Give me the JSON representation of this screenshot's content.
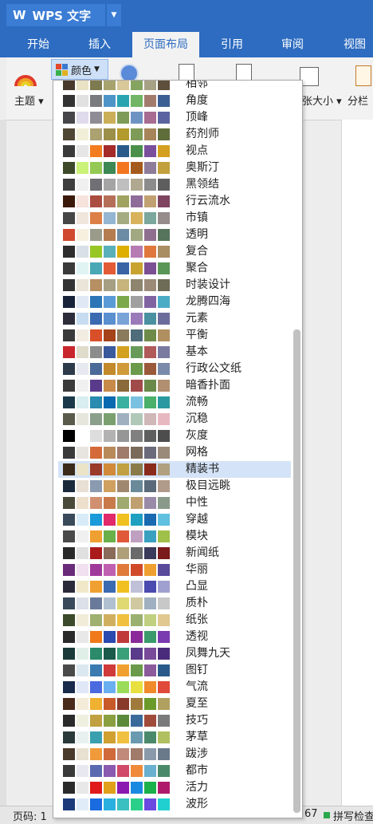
{
  "app": {
    "title": "WPS 文字",
    "logo_glyph": "W"
  },
  "tabs": [
    {
      "label": "开始"
    },
    {
      "label": "插入"
    },
    {
      "label": "页面布局",
      "active": true
    },
    {
      "label": "引用"
    },
    {
      "label": "审阅"
    },
    {
      "label": "视图"
    }
  ],
  "ribbon": {
    "theme_label": "主题",
    "colors_label": "颜色",
    "size_label": "纸张大小",
    "columns_label": "分栏"
  },
  "status": {
    "page_label": "页码: 1",
    "right_num": "67",
    "spellcheck": "拼写检查"
  },
  "color_schemes": [
    {
      "name": "相邻",
      "colors": [
        "#47392c",
        "#e9e2c5",
        "#7e7a4f",
        "#a6a36e",
        "#d8c89a",
        "#84a460",
        "#a6a084",
        "#5e4f3c"
      ]
    },
    {
      "name": "角度",
      "colors": [
        "#333333",
        "#e1e1e1",
        "#797b7e",
        "#4e95c7",
        "#2aa4b0",
        "#71b566",
        "#a37b6d",
        "#3c5f93"
      ]
    },
    {
      "name": "顶峰",
      "colors": [
        "#46464a",
        "#dfdbeb",
        "#8f8c95",
        "#cbaf58",
        "#7f9b59",
        "#6e93c3",
        "#a86c92",
        "#5c64a0"
      ]
    },
    {
      "name": "药剂师",
      "colors": [
        "#4f4633",
        "#f2efd8",
        "#aca171",
        "#9b8f4a",
        "#b39a2c",
        "#7e9b58",
        "#a8845a",
        "#5f6d3b"
      ]
    },
    {
      "name": "视点",
      "colors": [
        "#3a3a3a",
        "#e6e6e6",
        "#f37c20",
        "#a52a2a",
        "#2a5a8c",
        "#4a8f4a",
        "#7a4f9c",
        "#d4a020"
      ]
    },
    {
      "name": "奥斯汀",
      "colors": [
        "#3c4a2a",
        "#caf278",
        "#94c954",
        "#3e8853",
        "#f3761e",
        "#a55a1d",
        "#8e7c9a",
        "#c2a03d"
      ]
    },
    {
      "name": "黑领结",
      "colors": [
        "#3e3e3e",
        "#f0f0f0",
        "#6f6f74",
        "#a5a5a5",
        "#bfbfbf",
        "#b0a890",
        "#8c8c8c",
        "#5e5e5e"
      ]
    },
    {
      "name": "行云流水",
      "colors": [
        "#3b1a0b",
        "#f6e3dc",
        "#ab4c41",
        "#b56f59",
        "#a1a360",
        "#8e6b98",
        "#c1a172",
        "#7e4460"
      ]
    },
    {
      "name": "市镇",
      "colors": [
        "#464646",
        "#f0e6dc",
        "#dd8047",
        "#94b6d2",
        "#a5ab81",
        "#d8b25c",
        "#7ba79d",
        "#968c8c"
      ]
    },
    {
      "name": "透明",
      "colors": [
        "#d0492e",
        "#f7f0df",
        "#9b9b8b",
        "#b47c4f",
        "#6c8ba5",
        "#a1a882",
        "#8f6f8f",
        "#56745c"
      ]
    },
    {
      "name": "复合",
      "colors": [
        "#2d2d2d",
        "#d9e0e6",
        "#98c723",
        "#59b0b9",
        "#deae00",
        "#b77bb4",
        "#e0773c",
        "#a98d63"
      ]
    },
    {
      "name": "聚合",
      "colors": [
        "#3a3a3a",
        "#e0f4f4",
        "#4aa8b6",
        "#e35b36",
        "#3a63a6",
        "#c8a330",
        "#7c4f94",
        "#5a9656"
      ]
    },
    {
      "name": "时装设计",
      "colors": [
        "#333333",
        "#eae5d8",
        "#b68f63",
        "#a69f83",
        "#c7b47c",
        "#8e8570",
        "#9c8a78",
        "#6e6b56"
      ]
    },
    {
      "name": "龙腾四海",
      "colors": [
        "#18233a",
        "#e0e8f4",
        "#2d75b6",
        "#5b9bd5",
        "#7aa84a",
        "#a0a0a0",
        "#8064a2",
        "#4bacc6"
      ]
    },
    {
      "name": "元素",
      "colors": [
        "#2c2c3a",
        "#c7dcf0",
        "#3a6bb0",
        "#5a8fd0",
        "#7aa3d8",
        "#9a7ab8",
        "#4a90a0",
        "#6c6c9c"
      ]
    },
    {
      "name": "平衡",
      "colors": [
        "#3a3a3a",
        "#f2ece2",
        "#d94f2a",
        "#a5441a",
        "#8a7b5c",
        "#4f6c7a",
        "#6e8b4a",
        "#b09060"
      ]
    },
    {
      "name": "基本",
      "colors": [
        "#c8252c",
        "#e0dccc",
        "#8c8c8c",
        "#3a5a9c",
        "#d4a020",
        "#6a9a5a",
        "#b05a5a",
        "#7a7aa0"
      ]
    },
    {
      "name": "行政公文纸",
      "colors": [
        "#2c3a4a",
        "#e6eaf0",
        "#4a6a9a",
        "#c28a2a",
        "#d09a3a",
        "#6a9a4a",
        "#9a5a3a",
        "#7a8aaa"
      ]
    },
    {
      "name": "暗香扑面",
      "colors": [
        "#3a3a3a",
        "#f0f0f0",
        "#5a3a8a",
        "#c88a4a",
        "#8a6a3a",
        "#a04a4a",
        "#6a8a4a",
        "#b09070"
      ]
    },
    {
      "name": "流畅",
      "colors": [
        "#1a3a4a",
        "#d8eef0",
        "#2a8ab0",
        "#0a6ab0",
        "#3ab0a0",
        "#7ac0e0",
        "#4ab06a",
        "#2a9aa0"
      ]
    },
    {
      "name": "沉稳",
      "colors": [
        "#5a5a4a",
        "#e6e6dc",
        "#8aa08a",
        "#7aa070",
        "#a0b0c0",
        "#b0c8b8",
        "#d0b8b8",
        "#e8b8c0"
      ]
    },
    {
      "name": "灰度",
      "colors": [
        "#000000",
        "#ffffff",
        "#dddddd",
        "#b2b2b2",
        "#969696",
        "#808080",
        "#5f5f5f",
        "#4d4d4d"
      ]
    },
    {
      "name": "网格",
      "colors": [
        "#3a3a3a",
        "#e8e4e0",
        "#d46a3a",
        "#b88a5a",
        "#a07a6a",
        "#7a6a5a",
        "#6a6a7a",
        "#9a8a7a"
      ]
    },
    {
      "name": "精装书",
      "colors": [
        "#3a2a1a",
        "#ece4c8",
        "#9a3a2a",
        "#d08a3a",
        "#c0a040",
        "#8a7a4a",
        "#8a2a1a",
        "#b0a080"
      ]
    },
    {
      "name": "极目远眺",
      "colors": [
        "#1a2a3a",
        "#e8e0d4",
        "#8a9ab0",
        "#d0a060",
        "#a08870",
        "#6a8a9a",
        "#5a6a7a",
        "#b09a8a"
      ]
    },
    {
      "name": "中性",
      "colors": [
        "#4a4a3a",
        "#ece0cc",
        "#d09070",
        "#c87a4a",
        "#a0aa70",
        "#c0a070",
        "#9a8aaa",
        "#8a9a8a"
      ]
    },
    {
      "name": "穿越",
      "colors": [
        "#3a4a5a",
        "#d8ecf8",
        "#1a9ad8",
        "#e02a6a",
        "#f0c020",
        "#20a0c0",
        "#1a6ab0",
        "#60c0e0"
      ]
    },
    {
      "name": "模块",
      "colors": [
        "#4a4a4a",
        "#f0f0f0",
        "#f0a030",
        "#6ab04a",
        "#e05a3a",
        "#c0a0c0",
        "#3aa0c0",
        "#a0c04a"
      ]
    },
    {
      "name": "新闻纸",
      "colors": [
        "#2a2a2a",
        "#e0e0e0",
        "#aa1a1a",
        "#8a6a5a",
        "#b0a07a",
        "#6a6a6a",
        "#3a3a5a",
        "#7a1a1a"
      ]
    },
    {
      "name": "华丽",
      "colors": [
        "#6a2a7a",
        "#f0e0f0",
        "#a03a9a",
        "#c060b0",
        "#e07a3a",
        "#d04a2a",
        "#f0a030",
        "#5a4a9a"
      ]
    },
    {
      "name": "凸显",
      "colors": [
        "#2a2a3a",
        "#f0e8c8",
        "#f0a030",
        "#3a6ab0",
        "#f0c020",
        "#c0c0d8",
        "#4a4ab0",
        "#a0a0d0"
      ]
    },
    {
      "name": "质朴",
      "colors": [
        "#3a4a5a",
        "#dce0e8",
        "#6a7a9a",
        "#b0c0d0",
        "#e0d870",
        "#d0c8a0",
        "#a0b0c0",
        "#c8c8c8"
      ]
    },
    {
      "name": "纸张",
      "colors": [
        "#3a4a2a",
        "#f0ecd8",
        "#a0b070",
        "#d0b060",
        "#f0c040",
        "#9ab070",
        "#c0d080",
        "#e0c890"
      ]
    },
    {
      "name": "透视",
      "colors": [
        "#2a2a2a",
        "#e8e8e8",
        "#f07a1a",
        "#2a4ab0",
        "#c03a3a",
        "#8a2a9a",
        "#3a9a6a",
        "#7a3ab0"
      ]
    },
    {
      "name": "凤舞九天",
      "colors": [
        "#1a3a3a",
        "#e0f0e8",
        "#2a8a6a",
        "#1a5a4a",
        "#3aa07a",
        "#5a3a8a",
        "#7a4a9a",
        "#4a2a7a"
      ]
    },
    {
      "name": "图钉",
      "colors": [
        "#4a4a4a",
        "#dce8f0",
        "#3a7ab0",
        "#d03a3a",
        "#f0a030",
        "#6a9a4a",
        "#8a5a9a",
        "#2a5a8a"
      ]
    },
    {
      "name": "气流",
      "colors": [
        "#1a2a4a",
        "#e0e8f8",
        "#4a6ae0",
        "#6ab0f0",
        "#9adc5a",
        "#e8e040",
        "#f08a2a",
        "#e04a3a"
      ]
    },
    {
      "name": "夏至",
      "colors": [
        "#4a2a1a",
        "#f4ecd8",
        "#f0b030",
        "#c85a2a",
        "#8a3a2a",
        "#a07a3a",
        "#6a9a2a",
        "#b0a060"
      ]
    },
    {
      "name": "技巧",
      "colors": [
        "#2a2a2a",
        "#f0f0e0",
        "#c0a040",
        "#8aa040",
        "#5a8a3a",
        "#3a6a9a",
        "#a04a3a",
        "#7a7a7a"
      ]
    },
    {
      "name": "茅草",
      "colors": [
        "#2a3a3a",
        "#e8f0f0",
        "#3aa0b0",
        "#d0a030",
        "#f0c040",
        "#6a9ab0",
        "#4a8a6a",
        "#b0c060"
      ]
    },
    {
      "name": "跋涉",
      "colors": [
        "#4a3a2a",
        "#e8e0d0",
        "#f09a3a",
        "#d06a3a",
        "#c08a7a",
        "#a07a6a",
        "#8a9aaa",
        "#6a7a8a"
      ]
    },
    {
      "name": "都市",
      "colors": [
        "#3a3a3a",
        "#e8e8f0",
        "#5a6ab0",
        "#8a5ab0",
        "#d04a6a",
        "#f08a3a",
        "#6ab0d0",
        "#4a8a6a"
      ]
    },
    {
      "name": "活力",
      "colors": [
        "#2a2a2a",
        "#e8e8e8",
        "#e01a1a",
        "#e0a01a",
        "#8a1ab0",
        "#1a8ae0",
        "#1ab04a",
        "#b01a6a"
      ]
    },
    {
      "name": "波形",
      "colors": [
        "#1a3a7a",
        "#e0ecf8",
        "#1a6ae0",
        "#2ab0e0",
        "#3ac0c0",
        "#2ad08a",
        "#6a4ae0",
        "#20d0d0"
      ]
    }
  ]
}
